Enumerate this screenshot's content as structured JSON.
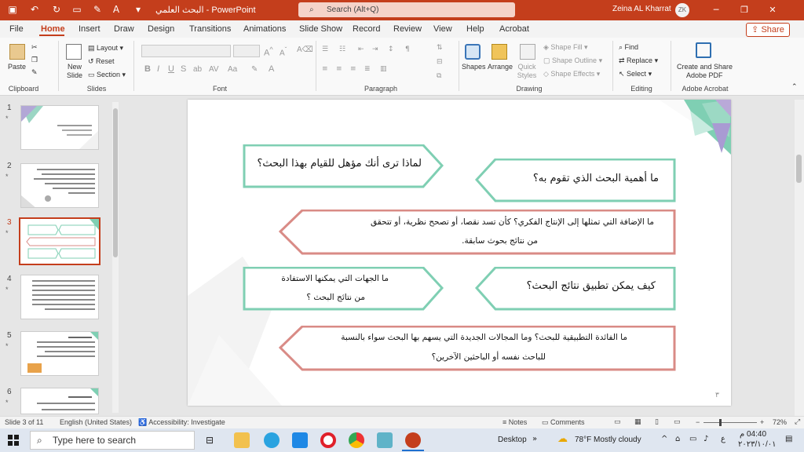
{
  "titlebar": {
    "doc_title": "البحث العلمي  -  PowerPoint",
    "search_placeholder": "Search (Alt+Q)",
    "user_name": "Zeina AL Kharrat",
    "avatar_text": "ZK",
    "autosave_icon": "toggle-icon",
    "colors": {
      "accent": "#c43e1c"
    }
  },
  "menu": {
    "tabs": [
      "File",
      "Home",
      "Insert",
      "Draw",
      "Design",
      "Transitions",
      "Animations",
      "Slide Show",
      "Record",
      "Review",
      "View",
      "Help",
      "Acrobat"
    ],
    "active_tab": "Home",
    "share_label": "Share"
  },
  "ribbon": {
    "paste": "Paste",
    "new_slide": "New Slide",
    "layout": "Layout",
    "reset": "Reset",
    "section": "Section",
    "shapes": "Shapes",
    "arrange": "Arrange",
    "quick_styles": "Quick Styles",
    "shape_fill": "Shape Fill",
    "shape_outline": "Shape Outline",
    "shape_effects": "Shape Effects",
    "find": "Find",
    "replace": "Replace",
    "select": "Select",
    "create_share": "Create and Share",
    "adobe_pdf": "Adobe PDF",
    "groups": [
      "Clipboard",
      "Slides",
      "Font",
      "Paragraph",
      "Drawing",
      "Editing",
      "Adobe Acrobat"
    ]
  },
  "thumbnails": [
    {
      "num": "1",
      "star": "*"
    },
    {
      "num": "2",
      "star": "*"
    },
    {
      "num": "3",
      "star": "*",
      "selected": true
    },
    {
      "num": "4",
      "star": "*"
    },
    {
      "num": "5",
      "star": "*"
    },
    {
      "num": "6",
      "star": "*"
    }
  ],
  "slide": {
    "boxes": {
      "importance": "ما أهمية البحث الذي تقوم به؟",
      "qualified": "لماذا ترى أنك مؤهل للقيام بهذا البحث؟",
      "addition_line1": "ما الإضافة التي تمثلها إلى الإنتاج الفكري؟ كأن تسد نقصا، أو تصحح نظرية، أو تتحقق",
      "addition_line2": "من نتائج بحوث سابقة.",
      "apply": "كيف يمكن تطبيق نتائج البحث؟",
      "parties_line1": "ما الجهات التي يمكنها الاستفادة",
      "parties_line2": "من نتائج البحث ؟",
      "benefit_line1": "ما الفائدة التطبيقية للبحث؟ وما المجالات الجديدة التي يسهم بها البحث سواء بالنسبة",
      "benefit_line2": "للباحث نفسه أو الباحثين الآخرين؟"
    },
    "page_number": "٣",
    "colors": {
      "green": "#7fcfb3",
      "pink": "#d98b86"
    }
  },
  "status": {
    "slide_info": "Slide 3 of 11",
    "language": "English (United States)",
    "accessibility": "Accessibility: Investigate",
    "notes": "Notes",
    "comments": "Comments",
    "zoom": "72%"
  },
  "taskbar": {
    "search_placeholder": "Type here to search",
    "desktop": "Desktop",
    "weather": "78°F  Mostly cloudy",
    "lang": "ع",
    "time": "04:40 م",
    "date": "٢٠٢٣/١٠/٠١"
  }
}
